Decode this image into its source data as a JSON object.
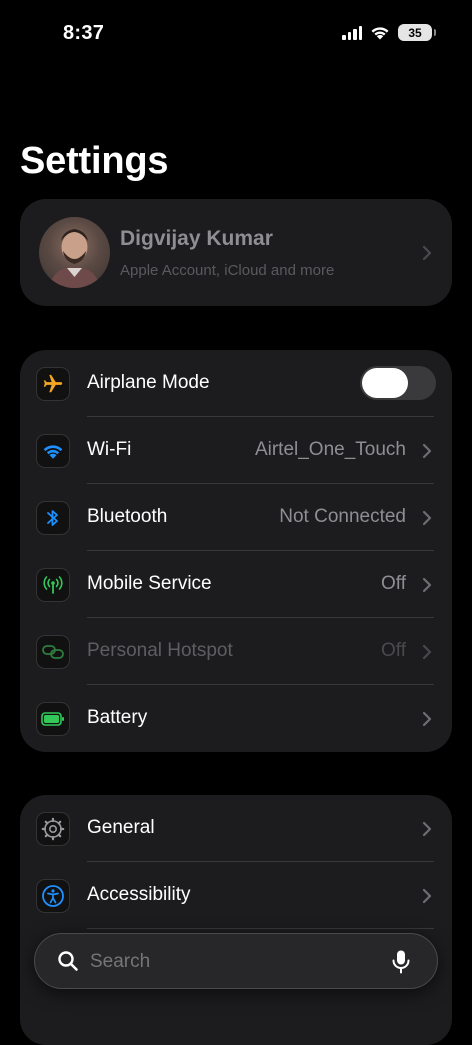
{
  "status_bar": {
    "time": "8:37",
    "battery": "35"
  },
  "title": "Settings",
  "profile": {
    "name": "Digvijay Kumar",
    "subtitle": "Apple Account, iCloud and more"
  },
  "connectivity": {
    "airplane": {
      "label": "Airplane Mode",
      "icon": "airplane-icon",
      "toggle_on": false
    },
    "wifi": {
      "label": "Wi-Fi",
      "value": "Airtel_One_Touch",
      "icon": "wifi-icon"
    },
    "bluetooth": {
      "label": "Bluetooth",
      "value": "Not Connected",
      "icon": "bluetooth-icon"
    },
    "mobile": {
      "label": "Mobile Service",
      "value": "Off",
      "icon": "antenna-icon"
    },
    "hotspot": {
      "label": "Personal Hotspot",
      "value": "Off",
      "icon": "hotspot-icon"
    },
    "battery": {
      "label": "Battery",
      "icon": "battery-icon"
    }
  },
  "general_group": {
    "general": {
      "label": "General",
      "icon": "gear-icon"
    },
    "accessibility": {
      "label": "Accessibility",
      "icon": "accessibility-icon"
    }
  },
  "search": {
    "placeholder": "Search"
  },
  "colors": {
    "airplane": "#f5a623",
    "wifi": "#1e90ff",
    "bluetooth": "#1e90ff",
    "mobile": "#34c759",
    "hotspot": "#2e7d3e",
    "battery": "#34c759",
    "accessibility": "#1e90ff"
  }
}
